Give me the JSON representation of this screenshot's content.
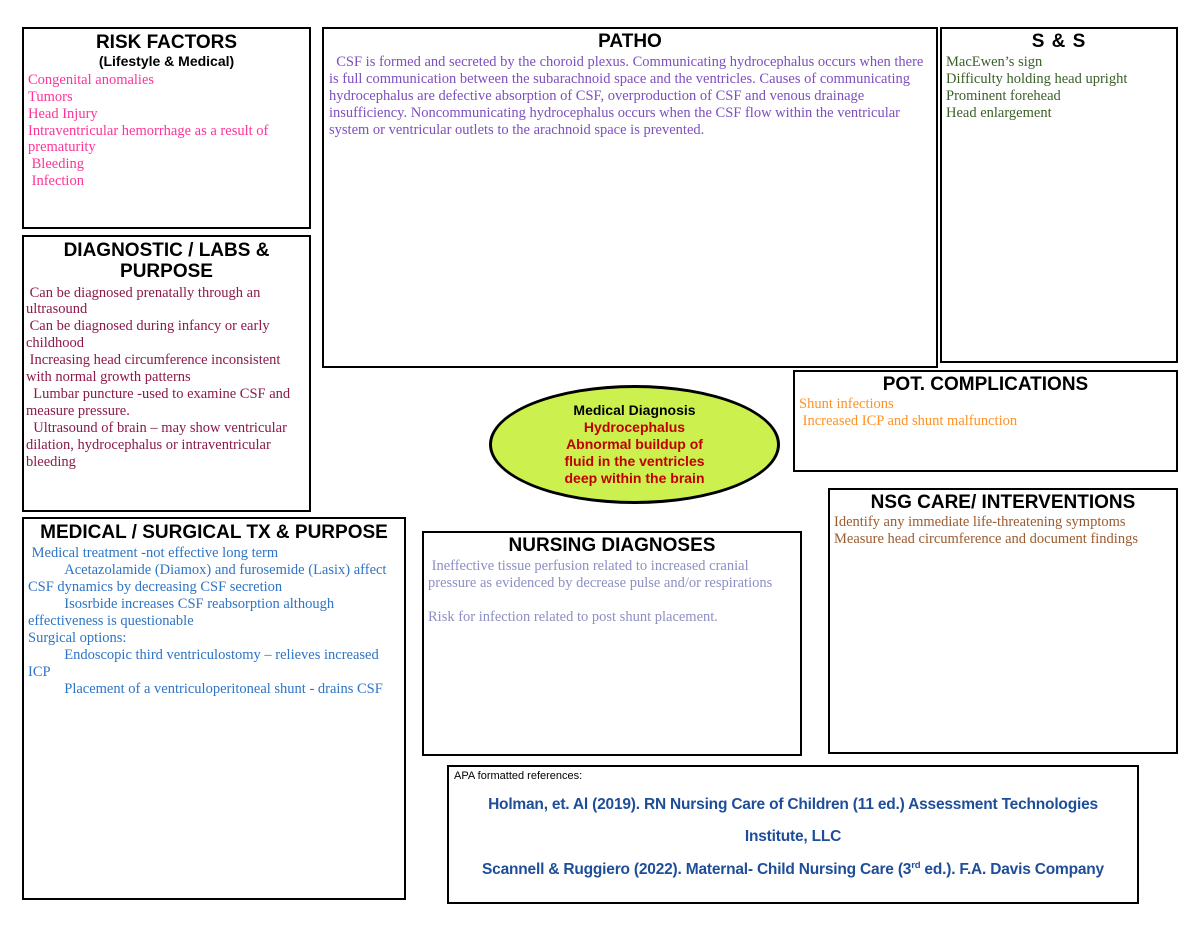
{
  "risk_factors": {
    "title": "RISK FACTORS",
    "subtitle": "(Lifestyle & Medical)",
    "body": "Congenital anomalies\nTumors\nHead Injury\nIntraventricular hemorrhage as a result of prematurity\n Bleeding\n Infection",
    "color": "#FF3399"
  },
  "diagnostic": {
    "title": "DIAGNOSTIC / LABS & PURPOSE",
    "body": " Can be diagnosed prenatally through an ultrasound\n Can be diagnosed during infancy or early childhood\n Increasing head circumference inconsistent with normal growth patterns\n  Lumbar puncture -used to examine CSF and measure pressure.\n  Ultrasound of brain – may show ventricular dilation, hydrocephalus or intraventricular bleeding",
    "color": "#8B1A4A"
  },
  "medsurg": {
    "title": "MEDICAL / SURGICAL TX & PURPOSE",
    "body": " Medical treatment -not effective long term\n          Acetazolamide (Diamox) and furosemide (Lasix) affect CSF dynamics by decreasing CSF secretion\n          Isosrbide increases CSF reabsorption although effectiveness is questionable\nSurgical options:\n          Endoscopic third ventriculostomy – relieves increased ICP\n          Placement of a ventriculoperitoneal shunt - drains CSF",
    "color": "#2E74C6"
  },
  "patho": {
    "title": "PATHO",
    "body": "  CSF is formed and secreted by the choroid plexus. Communicating hydrocephalus occurs when there is full communication between the subarachnoid space and the ventricles. Causes of communicating hydrocephalus are defective absorption of CSF, overproduction of CSF and venous drainage insufficiency. Noncommunicating hydrocephalus occurs when the CSF flow within the ventricular system or ventricular outlets to the arachnoid space is prevented.",
    "color": "#7D4FBF"
  },
  "signs_symptoms": {
    "title": "S & S",
    "body": "MacEwen’s sign\nDifficulty holding head upright\nProminent forehead\nHead enlargement",
    "color": "#3A5F27"
  },
  "complications": {
    "title": "POT. COMPLICATIONS",
    "body": "Shunt infections\n Increased ICP and shunt malfunction",
    "color": "#FF9226"
  },
  "nsg_care": {
    "title": "NSG CARE/ INTERVENTIONS",
    "body": "Identify any immediate life-threatening symptoms\nMeasure head circumference and document findings",
    "color": "#9C5B2E"
  },
  "nursing_diagnoses": {
    "title": "NURSING DIAGNOSES",
    "body": " Ineffective tissue perfusion related to increased cranial pressure as evidenced by decrease pulse and/or respirations\n\nRisk for infection related to post shunt placement.",
    "color": "#8D8FC4"
  },
  "diagnosis_oval": {
    "label": "Medical Diagnosis",
    "text": "Hydrocephalus\nAbnormal buildup of\nfluid in the ventricles\ndeep within the brain",
    "fill": "#CCF04E",
    "label_color": "#000000",
    "text_color": "#C00000"
  },
  "references": {
    "label": "APA formatted references:",
    "line1_part1": "Holman, et. Al (2019). RN Nursing Care of Children (11 ed.) Assessment Technologies",
    "line2": "Institute, LLC",
    "line3_before": "Scannell & Ruggiero (2022). Maternal- Child Nursing Care (3",
    "line3_sup": "rd",
    "line3_after": " ed.). F.A. Davis Company",
    "color": "#1F4E99"
  }
}
